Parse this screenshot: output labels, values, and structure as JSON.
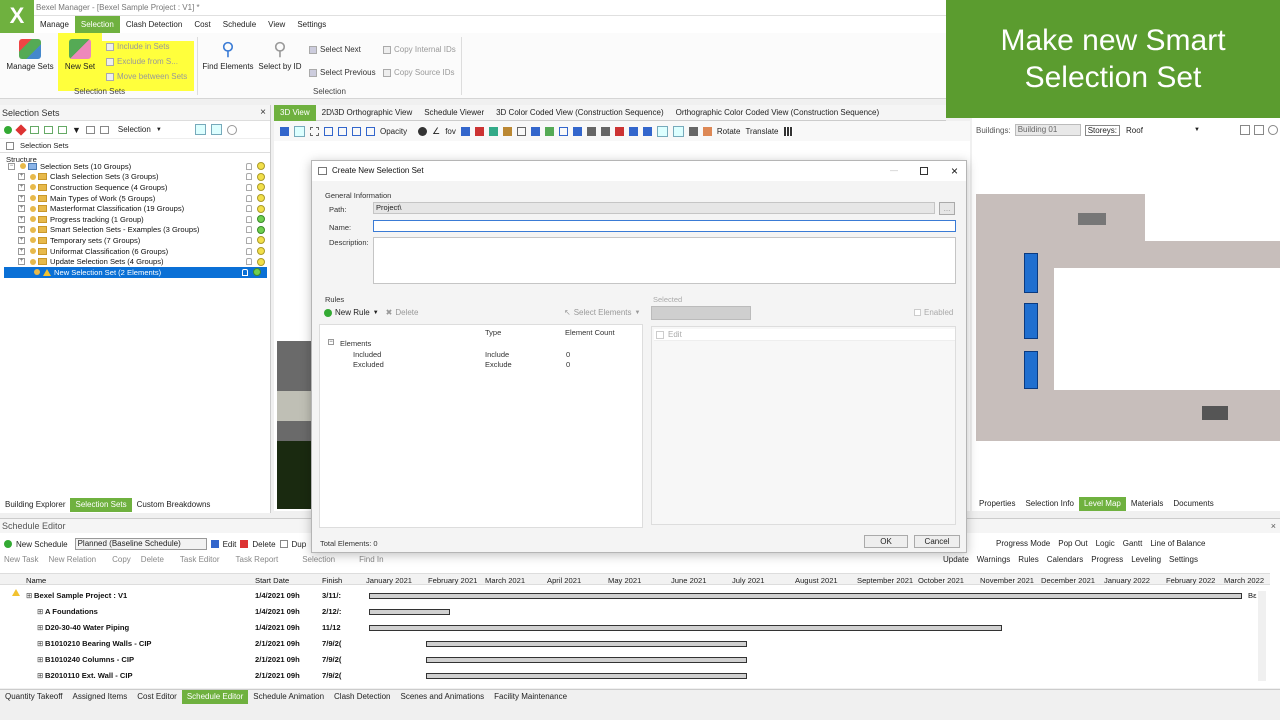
{
  "window": {
    "title": "Bexel Manager - [Bexel Sample Project : V1] *",
    "logo": "X"
  },
  "menu": [
    "Manage",
    "Selection",
    "Clash Detection",
    "Cost",
    "Schedule",
    "View",
    "Settings"
  ],
  "ribbon": {
    "manage_sets": "Manage Sets",
    "new_set": "New Set",
    "include_in_sets": "Include in Sets",
    "exclude_from": "Exclude from S...",
    "move_between_sets": "Move between Sets",
    "group1": "Selection Sets",
    "find_elements": "Find Elements",
    "select_by_id": "Select by ID",
    "select_next": "Select Next",
    "select_previous": "Select Previous",
    "copy_internal_ids": "Copy Internal IDs",
    "copy_source_ids": "Copy Source IDs",
    "group2": "Selection"
  },
  "banner": {
    "line1": "Make new Smart",
    "line2": "Selection Set"
  },
  "left_panel": {
    "title": "Selection Sets",
    "close": "×",
    "toolbar_label": "Selection",
    "subtab": "Selection Sets",
    "structure": "Structure",
    "tree": [
      "Selection Sets (10 Groups)",
      "Clash Selection Sets (3 Groups)",
      "Construction Sequence (4 Groups)",
      "Main Types of Work (5 Groups)",
      "Masterformat Classification (19 Groups)",
      "Progress tracking (1 Group)",
      "Smart Selection Sets - Examples (3 Groups)",
      "Temporary sets (7 Groups)",
      "Uniformat Classification (6 Groups)",
      "Update Selection Sets (4 Groups)",
      "New Selection Set (2 Elements)"
    ],
    "tabs": [
      "Building Explorer",
      "Selection Sets",
      "Custom Breakdowns"
    ]
  },
  "view_tabs": [
    "3D View",
    "2D\\3D Orthographic View",
    "Schedule Viewer",
    "3D Color Coded View (Construction Sequence)",
    "Orthographic Color Coded View (Construction Sequence)"
  ],
  "view_toolbar": {
    "opacity": "Opacity",
    "fov": "fov",
    "rotate": "Rotate",
    "translate": "Translate"
  },
  "right_toolbar": {
    "buildings_label": "Buildings:",
    "building": "Building 01",
    "storeys_label": "Storeys:",
    "storey": "Roof"
  },
  "right_tabs": [
    "Properties",
    "Selection Info",
    "Level Map",
    "Materials",
    "Documents"
  ],
  "dialog": {
    "title": "Create New Selection Set",
    "general": "General Information",
    "path_label": "Path:",
    "path_value": "Project\\",
    "browse": "...",
    "name_label": "Name:",
    "name_value": "",
    "desc_label": "Description:",
    "rules": "Rules",
    "new_rule": "New Rule",
    "delete": "Delete",
    "select_elements": "Select Elements",
    "selected": "Selected",
    "enabled": "Enabled",
    "edit": "Edit",
    "col_type": "Type",
    "col_count": "Element Count",
    "elements": "Elements",
    "included": "Included",
    "included_type": "Include",
    "included_count": "0",
    "excluded": "Excluded",
    "excluded_type": "Exclude",
    "excluded_count": "0",
    "total": "Total Elements: 0",
    "ok": "OK",
    "cancel": "Cancel"
  },
  "schedule": {
    "title": "Schedule Editor",
    "new_schedule": "New Schedule",
    "schedule_select": "Planned (Baseline Schedule)",
    "edit": "Edit",
    "delete": "Delete",
    "dup": "Dup",
    "new_task": "New Task",
    "new_relation": "New Relation",
    "copy": "Copy",
    "delete2": "Delete",
    "task_editor": "Task Editor",
    "task_report": "Task Report",
    "selection": "Selection",
    "find_in": "Find In",
    "progress_mode": "Progress Mode",
    "pop_out": "Pop Out",
    "logic": "Logic",
    "gantt": "Gantt",
    "line_of_balance": "Line of Balance",
    "update": "Update",
    "warnings": "Warnings",
    "rules": "Rules",
    "calendars": "Calendars",
    "progress": "Progress",
    "leveling": "Leveling",
    "settings": "Settings",
    "col_name": "Name",
    "col_start": "Start Date",
    "col_finish": "Finish",
    "months": [
      "January 2021",
      "February 2021",
      "March 2021",
      "April 2021",
      "May 2021",
      "June 2021",
      "July 2021",
      "August 2021",
      "September 2021",
      "October 2021",
      "November 2021",
      "December 2021",
      "January 2022",
      "February 2022",
      "March 2022"
    ],
    "rows": [
      {
        "name": "Bexel Sample Project : V1",
        "start": "1/4/2021 09h",
        "finish": "3/11/:"
      },
      {
        "name": "A Foundations",
        "start": "1/4/2021 09h",
        "finish": "2/12/:"
      },
      {
        "name": "D20-30-40 Water Piping",
        "start": "1/4/2021 09h",
        "finish": "11/12"
      },
      {
        "name": "B1010210 Bearing Walls - CIP",
        "start": "2/1/2021 09h",
        "finish": "7/9/2("
      },
      {
        "name": "B1010240 Columns - CIP",
        "start": "2/1/2021 09h",
        "finish": "7/9/2("
      },
      {
        "name": "B2010110 Ext. Wall - CIP",
        "start": "2/1/2021 09h",
        "finish": "7/9/2("
      }
    ],
    "gantt_end_label": "Bε"
  },
  "bottom_tabs": [
    "Quantity Takeoff",
    "Assigned Items",
    "Cost Editor",
    "Schedule Editor",
    "Schedule Animation",
    "Clash Detection",
    "Scenes and Animations",
    "Facility Maintenance"
  ],
  "colors": {
    "accent": "#6fb13f",
    "banner": "#5b9c2f",
    "selected": "#0a70d6",
    "highlight": "#ffff3c"
  }
}
